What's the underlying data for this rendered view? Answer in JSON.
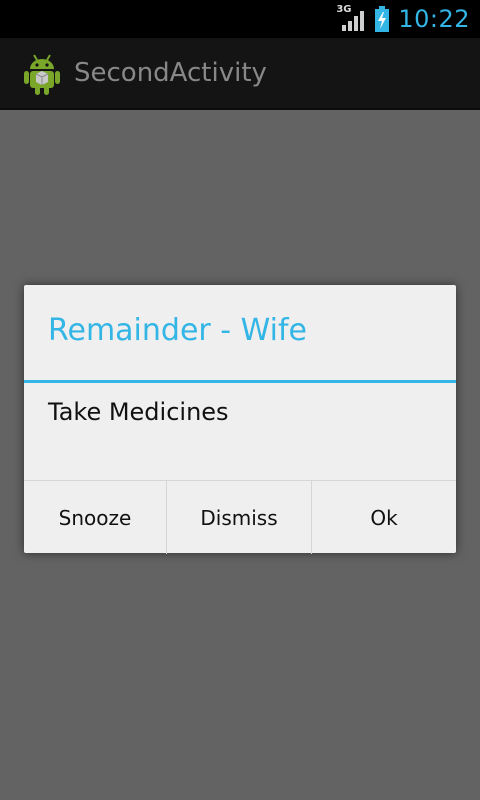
{
  "status_bar": {
    "network_label": "3G",
    "time": "10:22",
    "icons": [
      "signal-icon",
      "battery-charging-icon"
    ]
  },
  "action_bar": {
    "app_icon": "android-icon",
    "title": "SecondActivity"
  },
  "dialog": {
    "title": "Remainder - Wife",
    "message": "Take Medicines",
    "buttons": [
      "Snooze",
      "Dismiss",
      "Ok"
    ]
  },
  "colors": {
    "accent": "#33b5e5",
    "background_dim": "#636363",
    "dialog_bg": "#efefef"
  }
}
